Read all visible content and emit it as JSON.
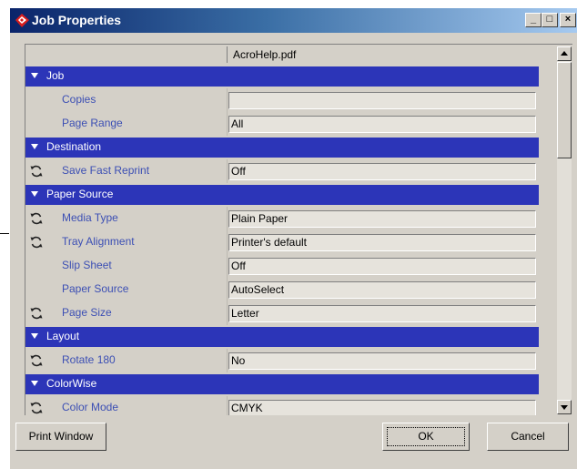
{
  "window": {
    "title": "Job Properties",
    "minimize": "_",
    "maximize": "□",
    "close": "×"
  },
  "grid": {
    "column_header": "AcroHelp.pdf"
  },
  "rows": [
    {
      "kind": "section",
      "label": "Job"
    },
    {
      "kind": "field",
      "label": "Copies",
      "value": "",
      "sync": false
    },
    {
      "kind": "field",
      "label": "Page Range",
      "value": "All",
      "sync": false
    },
    {
      "kind": "section",
      "label": "Destination"
    },
    {
      "kind": "field",
      "label": "Save Fast Reprint",
      "value": "Off",
      "sync": true
    },
    {
      "kind": "section",
      "label": "Paper Source"
    },
    {
      "kind": "field",
      "label": "Media Type",
      "value": "Plain Paper",
      "sync": true
    },
    {
      "kind": "field",
      "label": "Tray Alignment",
      "value": "Printer's default",
      "sync": true
    },
    {
      "kind": "field",
      "label": "Slip Sheet",
      "value": "Off",
      "sync": false
    },
    {
      "kind": "field",
      "label": "Paper Source",
      "value": "AutoSelect",
      "sync": false
    },
    {
      "kind": "field",
      "label": "Page Size",
      "value": "Letter",
      "sync": true
    },
    {
      "kind": "section",
      "label": "Layout"
    },
    {
      "kind": "field",
      "label": "Rotate 180",
      "value": "No",
      "sync": true
    },
    {
      "kind": "section",
      "label": "ColorWise"
    },
    {
      "kind": "field",
      "label": "Color Mode",
      "value": "CMYK",
      "sync": true
    }
  ],
  "buttons": {
    "print_window": "Print Window",
    "ok": "OK",
    "cancel": "Cancel"
  },
  "colors": {
    "section_bg": "#2c35b8",
    "label_text": "#3c4fb4",
    "window_face": "#d4d0c8"
  },
  "icons": {
    "title": "job-properties-icon",
    "sync": "sync-arrows-icon",
    "expand": "triangle-down-icon"
  }
}
